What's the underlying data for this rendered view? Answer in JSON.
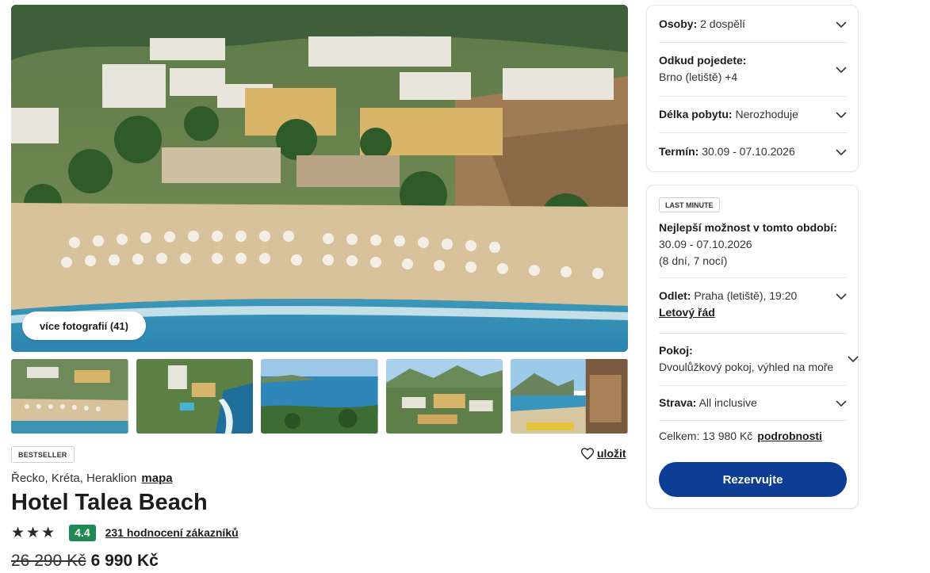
{
  "gallery": {
    "more_photos_label": "více fotografií (41)",
    "thumbnails": [
      "beach-overview",
      "aerial-pool",
      "bay-view",
      "hotel-town",
      "terrace-view"
    ]
  },
  "hotel": {
    "badge": "BESTSELLER",
    "save_label": "uložit",
    "location": "Řecko, Kréta, Heraklion",
    "map_link": "mapa",
    "name": "Hotel Talea Beach",
    "stars": 3,
    "score": "4.4",
    "reviews_link": "231 hodnocení zákazníků",
    "price_old": "26 290 Kč",
    "price_new": "6 990 Kč",
    "score_color": "#1f8a52"
  },
  "filters": {
    "persons_label": "Osoby:",
    "persons_value": "2 dospělí",
    "departure_label": "Odkud pojedete:",
    "departure_value": "Brno (letiště) +4",
    "length_label": "Délka pobytu:",
    "length_value": "Nerozhoduje",
    "date_label": "Termín:",
    "date_value": "30.09 - 07.10.2026"
  },
  "offer": {
    "badge": "LAST MINUTE",
    "best_title": "Nejlepší možnost v tomto období:",
    "best_dates": "30.09 - 07.10.2026",
    "best_nights": "(8 dní, 7 nocí)",
    "flight_label": "Odlet:",
    "flight_value": "Praha (letiště), 19:20",
    "schedule_link": "Letový řád",
    "room_label": "Pokoj:",
    "room_value": "Dvoulůžkový pokoj, výhled na moře",
    "board_label": "Strava:",
    "board_value": "All inclusive",
    "total_label": "Celkem: 13 980 Kč",
    "details_link": "podrobnosti",
    "reserve_label": "Rezervujte",
    "accent_color": "#0d3d94"
  },
  "icons": {
    "chevron": "chevron-down-icon",
    "heart": "heart-icon",
    "star": "star-icon"
  }
}
